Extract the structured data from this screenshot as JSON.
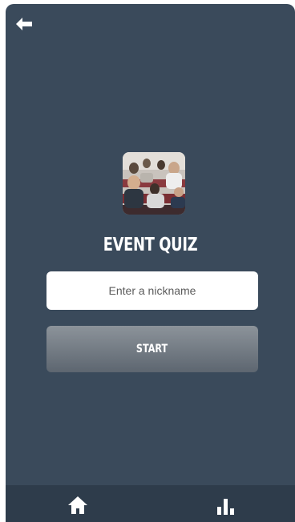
{
  "header": {
    "back_icon": "arrow-left-icon"
  },
  "quiz": {
    "image_alt": "event audience photo",
    "title": "EVENT QUIZ",
    "nickname_placeholder": "Enter a nickname",
    "nickname_value": "",
    "start_label": "START"
  },
  "bottom_nav": {
    "items": [
      {
        "icon": "home-icon"
      },
      {
        "icon": "bar-chart-icon"
      }
    ]
  },
  "colors": {
    "background": "#3a4a5b",
    "nav_background": "#2e3c4b",
    "button_top": "#8c939a",
    "button_bottom": "#5d6670"
  }
}
